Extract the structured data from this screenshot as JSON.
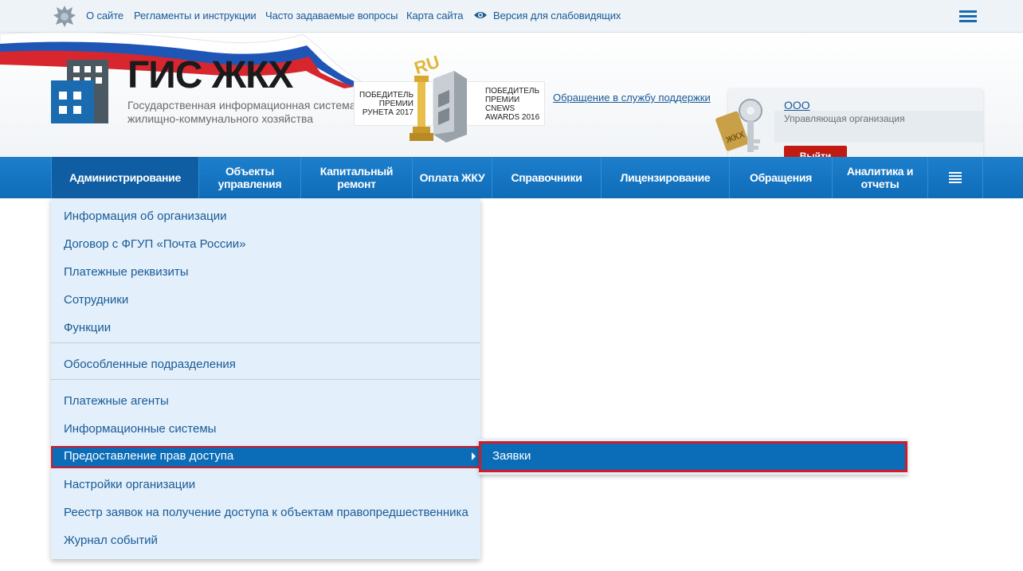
{
  "topbar": {
    "links": [
      "О сайте",
      "Регламенты и инструкции",
      "Часто задаваемые вопросы",
      "Карта сайта",
      "Версия для слабовидящих"
    ]
  },
  "header": {
    "logo_title": "ГИС ЖКХ",
    "logo_subtitle": "Государственная информационная система жилищно-коммунального хозяйства",
    "award_runet": "Победитель премии Рунета 2017",
    "award_cnews": "Победитель премии CNews Awards 2016",
    "support_link": "Обращение в службу поддержки"
  },
  "user": {
    "org_name": "ООО",
    "role": "Управляющая организация",
    "logout_label": "Выйти"
  },
  "nav": {
    "items": [
      "Администрирование",
      "Объекты управления",
      "Капитальный ремонт",
      "Оплата ЖКУ",
      "Справочники",
      "Лицензирование",
      "Обращения",
      "Аналитика и отчеты"
    ]
  },
  "dropdown": {
    "items": [
      "Информация об организации",
      "Договор с ФГУП «Почта России»",
      "Платежные реквизиты",
      "Сотрудники",
      "Функции",
      "Обособленные подразделения",
      "Платежные агенты",
      "Информационные системы",
      "Предоставление прав доступа",
      "Настройки организации",
      "Реестр заявок на получение доступа к объектам правопредшественника",
      "Журнал событий"
    ]
  },
  "submenu": {
    "items": [
      "Заявки"
    ]
  },
  "colors": {
    "nav_blue": "#1277c4",
    "highlight_red": "#d51927",
    "logout_red": "#c01a12"
  }
}
